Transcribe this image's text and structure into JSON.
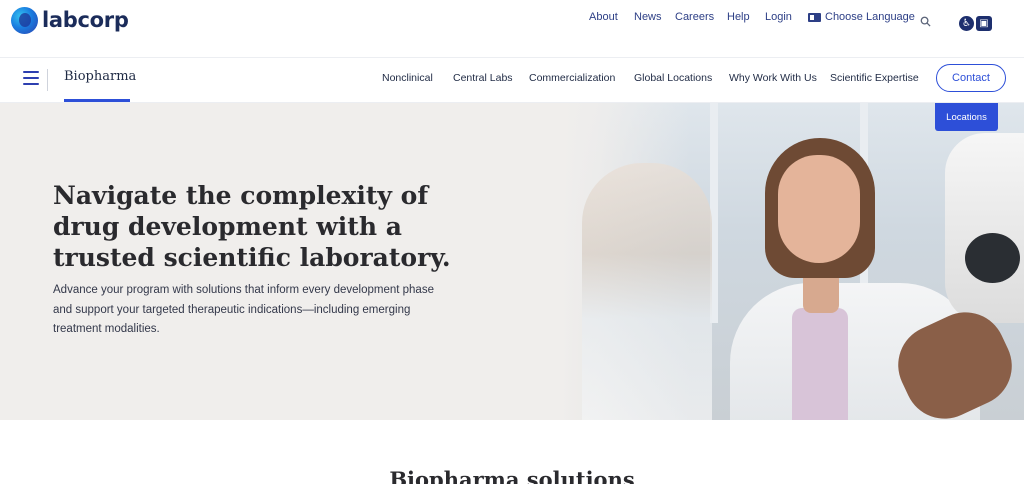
{
  "brand": {
    "name": "labcorp"
  },
  "utility_nav": {
    "about": "About",
    "news": "News",
    "careers": "Careers",
    "help": "Help",
    "login": "Login",
    "language": "Choose Language"
  },
  "icons": {
    "search": "search-icon",
    "language": "language-icon",
    "accessibility": "accessibility-icon"
  },
  "main_nav": {
    "section": "Biopharma",
    "items": [
      "Nonclinical",
      "Central Labs",
      "Commercialization",
      "Global Locations",
      "Why Work With Us",
      "Scientific Expertise"
    ],
    "contact": "Contact",
    "locations": "Locations"
  },
  "hero": {
    "title": "Navigate the complexity of drug development with a trusted scientific laboratory.",
    "text": "Advance your program with solutions that inform every development phase and support your targeted therapeutic indications—including emerging treatment modalities."
  },
  "solutions": {
    "heading": "Biopharma solutions"
  },
  "colors": {
    "accent": "#2d4fd8",
    "navy": "#1b2c5a",
    "hero_bg": "#f0eeec"
  }
}
